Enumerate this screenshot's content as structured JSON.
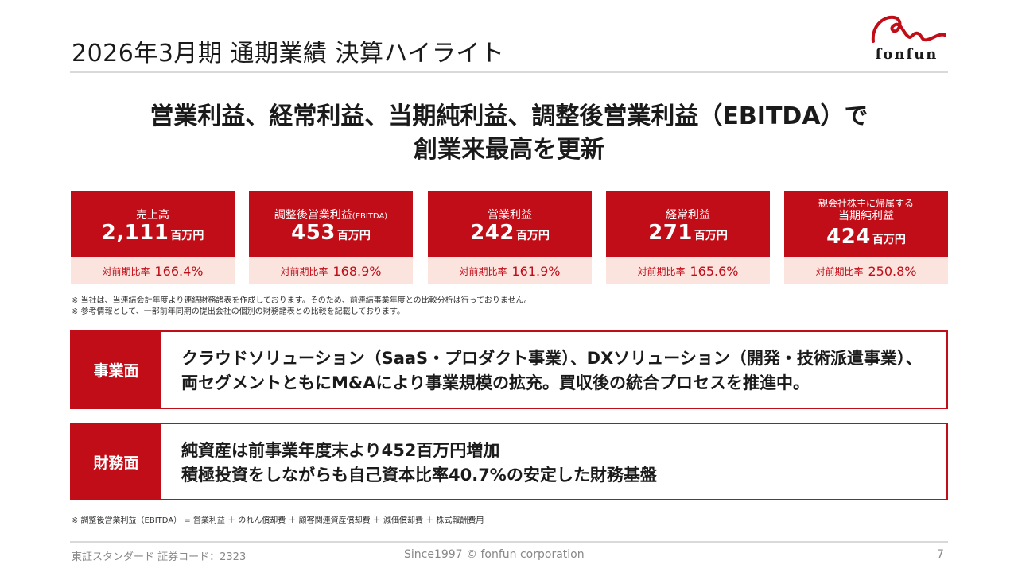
{
  "title": "2026年3月期 通期業績 決算ハイライト",
  "logo": {
    "text": "fonfun"
  },
  "headline": {
    "line1": "営業利益、経常利益、当期純利益、調整後営業利益（EBITDA）で",
    "line2": "創業来最高を更新"
  },
  "metrics": [
    {
      "label": "売上高",
      "value": "2,111",
      "unit": "百万円",
      "compare_label": "対前期比率",
      "compare_value": "166.4%"
    },
    {
      "label": "調整後営業利益",
      "label_suffix": "(EBITDA)",
      "value": "453",
      "unit": "百万円",
      "compare_label": "対前期比率",
      "compare_value": "168.9%"
    },
    {
      "label": "営業利益",
      "value": "242",
      "unit": "百万円",
      "compare_label": "対前期比率",
      "compare_value": "161.9%"
    },
    {
      "label": "経常利益",
      "value": "271",
      "unit": "百万円",
      "compare_label": "対前期比率",
      "compare_value": "165.6%"
    },
    {
      "label_line1": "親会社株主に帰属する",
      "label_line2": "当期純利益",
      "value": "424",
      "unit": "百万円",
      "compare_label": "対前期比率",
      "compare_value": "250.8%"
    }
  ],
  "notes": [
    "※ 当社は、当連結会計年度より連結財務諸表を作成しております。そのため、前連結事業年度との比較分析は行っておりません。",
    "※ 参考情報として、一部前年同期の提出会社の個別の財務諸表との比較を記載しております。"
  ],
  "business": {
    "label": "事業面",
    "line1": "クラウドソリューション（SaaS・プロダクト事業）、DXソリューション（開発・技術派遣事業）、",
    "line2": "両セグメントともにM&Aにより事業規模の拡充。買収後の統合プロセスを推進中。"
  },
  "financial": {
    "label": "財務面",
    "line1": "純資産は前事業年度末より452百万円増加",
    "line2": "積極投資をしながらも自己資本比率40.7%の安定した財務基盤"
  },
  "footnote": "※ 調整後営業利益（EBITDA） = 営業利益 ＋ のれん償却費 ＋ 顧客関連資産償却費 ＋ 減価償却費 ＋ 株式報酬費用",
  "footer": {
    "left": "東証スタンダード 証券コード：2323",
    "center": "Since1997 © fonfun corporation",
    "page": "7"
  },
  "colors": {
    "accent": "#c10d18",
    "accent_light": "#fbe3de",
    "rule": "#d9d9d9"
  }
}
